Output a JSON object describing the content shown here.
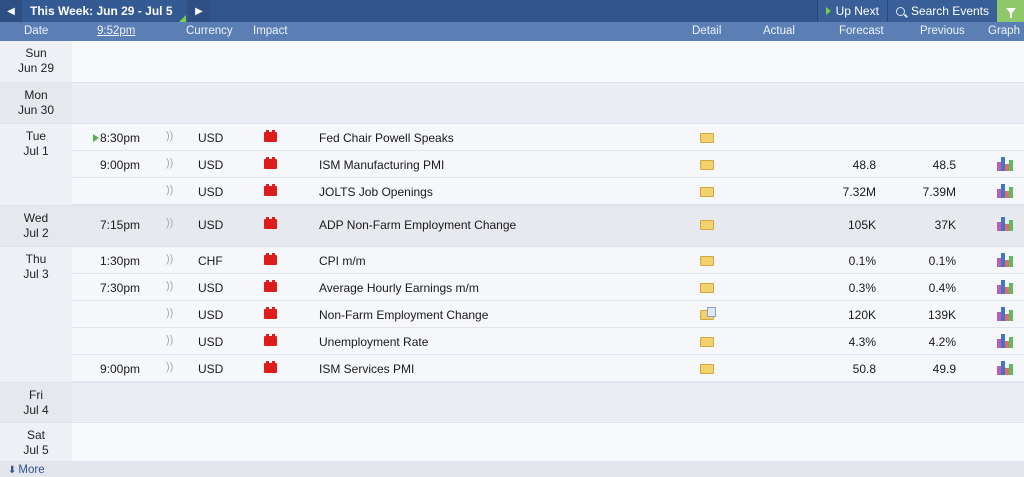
{
  "toolbar": {
    "week_label": "This Week: Jun 29 - Jul 5",
    "up_next": "Up Next",
    "search_events": "Search Events"
  },
  "header": {
    "date": "Date",
    "time": "9:52pm",
    "currency": "Currency",
    "impact": "Impact",
    "detail": "Detail",
    "actual": "Actual",
    "forecast": "Forecast",
    "previous": "Previous",
    "graph": "Graph"
  },
  "days": [
    {
      "weekday": "Sun",
      "date": "Jun 29"
    },
    {
      "weekday": "Mon",
      "date": "Jun 30"
    },
    {
      "weekday": "Tue",
      "date": "Jul 1"
    },
    {
      "weekday": "Wed",
      "date": "Jul 2"
    },
    {
      "weekday": "Thu",
      "date": "Jul 3"
    },
    {
      "weekday": "Fri",
      "date": "Jul 4"
    },
    {
      "weekday": "Sat",
      "date": "Jul 5"
    }
  ],
  "events": [
    {
      "time": "8:30pm",
      "currency": "USD",
      "name": "Fed Chair Powell Speaks",
      "forecast": "",
      "previous": ""
    },
    {
      "time": "9:00pm",
      "currency": "USD",
      "name": "ISM Manufacturing PMI",
      "forecast": "48.8",
      "previous": "48.5"
    },
    {
      "time": "",
      "currency": "USD",
      "name": "JOLTS Job Openings",
      "forecast": "7.32M",
      "previous": "7.39M"
    },
    {
      "time": "7:15pm",
      "currency": "USD",
      "name": "ADP Non-Farm Employment Change",
      "forecast": "105K",
      "previous": "37K"
    },
    {
      "time": "1:30pm",
      "currency": "CHF",
      "name": "CPI m/m",
      "forecast": "0.1%",
      "previous": "0.1%"
    },
    {
      "time": "7:30pm",
      "currency": "USD",
      "name": "Average Hourly Earnings m/m",
      "forecast": "0.3%",
      "previous": "0.4%"
    },
    {
      "time": "",
      "currency": "USD",
      "name": "Non-Farm Employment Change",
      "forecast": "120K",
      "previous": "139K"
    },
    {
      "time": "",
      "currency": "USD",
      "name": "Unemployment Rate",
      "forecast": "4.3%",
      "previous": "4.2%"
    },
    {
      "time": "9:00pm",
      "currency": "USD",
      "name": "ISM Services PMI",
      "forecast": "50.8",
      "previous": "49.9"
    }
  ],
  "footer": {
    "more": "More"
  },
  "colors": {
    "topbar": "#31558b",
    "header": "#5b7fb4",
    "impact_high": "#dd1c1c",
    "accent_green": "#7ccf47"
  }
}
